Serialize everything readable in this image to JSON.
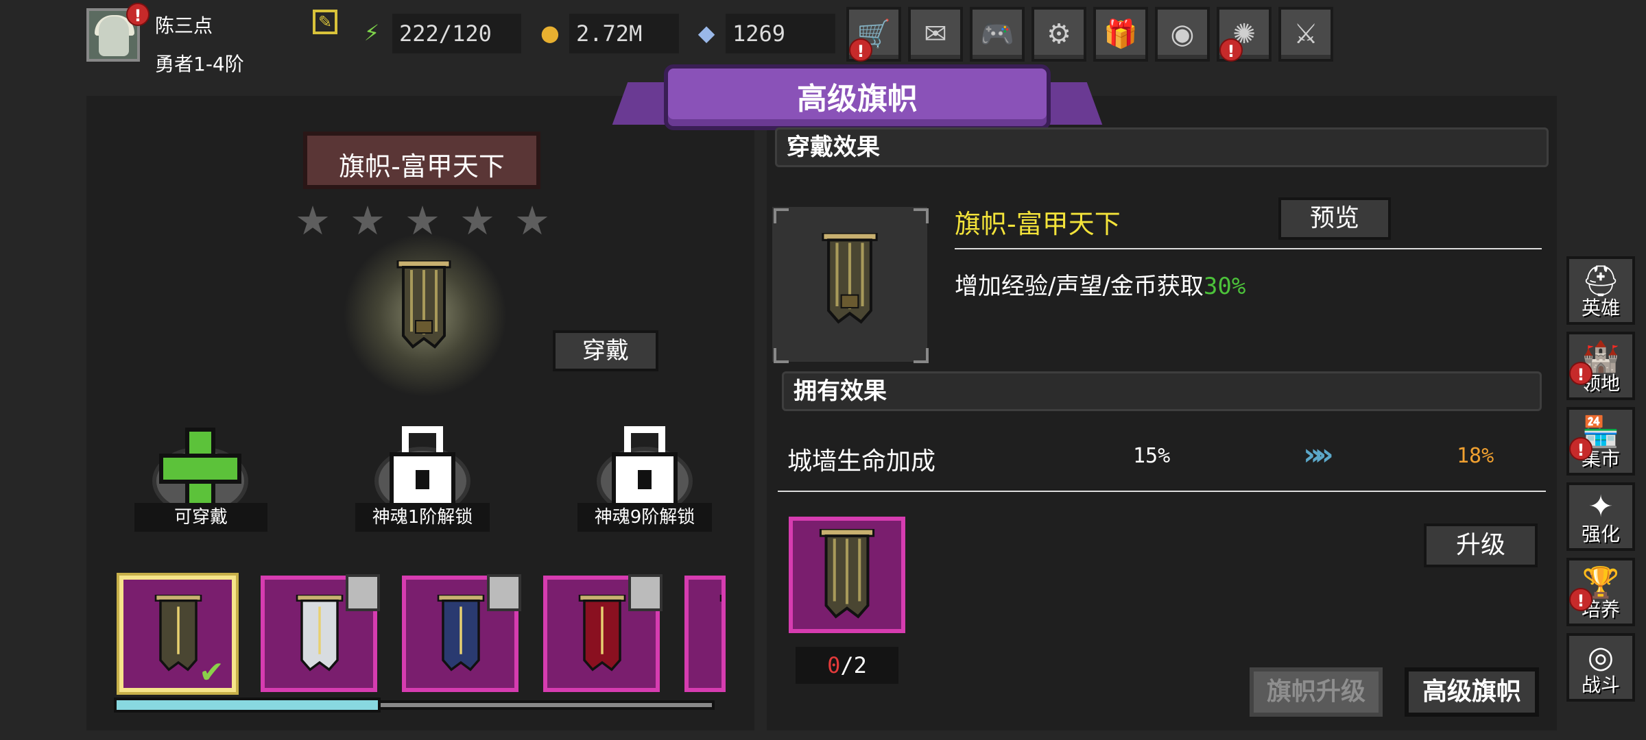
{
  "player": {
    "name": "陈三点",
    "rank": "勇者1-4阶",
    "avatar_alert": "!"
  },
  "resources": {
    "energy": "222/120",
    "gold": "2.72M",
    "gems": "1269"
  },
  "top_buttons": [
    {
      "icon": "shop-cart-icon",
      "glyph": "🛒",
      "alert": "!"
    },
    {
      "icon": "mail-icon",
      "glyph": "✉",
      "alert": ""
    },
    {
      "icon": "gamepad-icon",
      "glyph": "🎮",
      "alert": ""
    },
    {
      "icon": "gear-icon",
      "glyph": "⚙",
      "alert": ""
    },
    {
      "icon": "gift-icon",
      "glyph": "🎁",
      "alert": ""
    },
    {
      "icon": "color-wheel-icon",
      "glyph": "◉",
      "alert": ""
    },
    {
      "icon": "fireworks-icon",
      "glyph": "✺",
      "alert": "!"
    },
    {
      "icon": "crossed-swords-icon",
      "glyph": "⚔",
      "alert": ""
    }
  ],
  "header": {
    "title": "高级旗帜"
  },
  "flag": {
    "name": "旗帜-富甲天下",
    "stars_filled": 0,
    "stars_total": 5,
    "wear_label": "穿戴"
  },
  "slots": [
    {
      "label": "可穿戴",
      "state": "available"
    },
    {
      "label": "神魂1阶解锁",
      "state": "locked"
    },
    {
      "label": "神魂9阶解锁",
      "state": "locked"
    }
  ],
  "flag_cards": [
    {
      "name": "flag-1",
      "selected": true,
      "locked": false,
      "equipped": true
    },
    {
      "name": "flag-2",
      "selected": false,
      "locked": true,
      "equipped": false
    },
    {
      "name": "flag-3",
      "selected": false,
      "locked": true,
      "equipped": false
    },
    {
      "name": "flag-4",
      "selected": false,
      "locked": true,
      "equipped": false
    },
    {
      "name": "flag-5",
      "selected": false,
      "locked": false,
      "equipped": false
    }
  ],
  "scroll_progress": 0.29,
  "wear_effect": {
    "section_title": "穿戴效果",
    "item_name": "旗帜-富甲天下",
    "preview_label": "预览",
    "effect_text": "增加经验/声望/金币获取",
    "effect_value": "30%"
  },
  "own_effect": {
    "section_title": "拥有效果",
    "stat_name": "城墙生命加成",
    "from": "15%",
    "to": "18%"
  },
  "material": {
    "current": "0",
    "required": "/2"
  },
  "upgrade_label": "升级",
  "tabs": [
    {
      "label": "旗帜升级",
      "active": false
    },
    {
      "label": "高级旗帜",
      "active": true
    }
  ],
  "side_nav": [
    {
      "label": "英雄",
      "icon": "helmet-icon",
      "glyph": "⛑",
      "alert": ""
    },
    {
      "label": "领地",
      "icon": "castle-icon",
      "glyph": "🏰",
      "alert": "!"
    },
    {
      "label": "集市",
      "icon": "market-icon",
      "glyph": "🏪",
      "alert": "!"
    },
    {
      "label": "强化",
      "icon": "gem-frame-icon",
      "glyph": "✦",
      "alert": ""
    },
    {
      "label": "培养",
      "icon": "chalice-icon",
      "glyph": "🏆",
      "alert": "!"
    },
    {
      "label": "战斗",
      "icon": "portal-icon",
      "glyph": "◎",
      "alert": ""
    }
  ]
}
